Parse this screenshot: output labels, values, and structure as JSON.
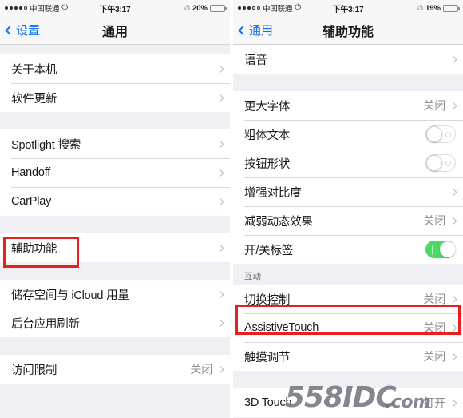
{
  "left": {
    "statusbar": {
      "carrier": "中国联通",
      "signal_filled": 4,
      "signal_empty": 1,
      "wifi_icon": "wifi-icon",
      "time": "下午3:17",
      "alarm_icon": "alarm-icon",
      "battery_percent": "20%",
      "battery_level": 20,
      "battery_color": "#e8423a"
    },
    "nav": {
      "back_label": "设置",
      "title": "通用"
    },
    "groups": [
      {
        "rows": [
          {
            "label": "关于本机",
            "type": "disclosure"
          },
          {
            "label": "软件更新",
            "type": "disclosure"
          }
        ]
      },
      {
        "rows": [
          {
            "label": "Spotlight 搜索",
            "type": "disclosure"
          },
          {
            "label": "Handoff",
            "type": "disclosure"
          },
          {
            "label": "CarPlay",
            "type": "disclosure"
          }
        ]
      },
      {
        "rows": [
          {
            "label": "辅助功能",
            "type": "disclosure",
            "highlight": true
          }
        ]
      },
      {
        "rows": [
          {
            "label": "储存空间与 iCloud 用量",
            "type": "disclosure"
          },
          {
            "label": "后台应用刷新",
            "type": "disclosure"
          }
        ]
      },
      {
        "rows": [
          {
            "label": "访问限制",
            "type": "disclosure",
            "value": "关闭"
          }
        ]
      }
    ]
  },
  "right": {
    "statusbar": {
      "carrier": "中国联通",
      "signal_filled": 3,
      "signal_empty": 2,
      "wifi_icon": "wifi-icon",
      "time": "下午3:17",
      "alarm_icon": "alarm-icon",
      "battery_percent": "19%",
      "battery_level": 19,
      "battery_color": "#e8423a"
    },
    "nav": {
      "back_label": "通用",
      "title": "辅助功能"
    },
    "groups": [
      {
        "rows": [
          {
            "label": "语音",
            "type": "disclosure"
          }
        ]
      },
      {
        "rows": [
          {
            "label": "更大字体",
            "type": "disclosure",
            "value": "关闭"
          },
          {
            "label": "粗体文本",
            "type": "toggle",
            "on": false
          },
          {
            "label": "按钮形状",
            "type": "toggle",
            "on": false
          },
          {
            "label": "增强对比度",
            "type": "disclosure"
          },
          {
            "label": "减弱动态效果",
            "type": "disclosure",
            "value": "关闭"
          },
          {
            "label": "开/关标签",
            "type": "toggle",
            "on": true
          }
        ]
      },
      {
        "header": "互动",
        "rows": [
          {
            "label": "切换控制",
            "type": "disclosure",
            "value": "关闭"
          },
          {
            "label": "AssistiveTouch",
            "type": "disclosure",
            "value": "关闭",
            "highlight": true
          },
          {
            "label": "触摸调节",
            "type": "disclosure",
            "value": "关闭"
          }
        ]
      },
      {
        "rows": [
          {
            "label": "3D Touch",
            "type": "disclosure",
            "value": "打开"
          }
        ]
      }
    ]
  },
  "watermark": {
    "main": "558IDC",
    "suffix": ".com",
    "color": "#6f737d"
  },
  "theme": {
    "accent_blue": "#0a74ef",
    "toggle_on_green": "#4cd964",
    "highlight_red": "#e8201d",
    "group_bg": "#efeff4",
    "row_bg": "#ffffff",
    "value_gray": "#8e8e93"
  }
}
